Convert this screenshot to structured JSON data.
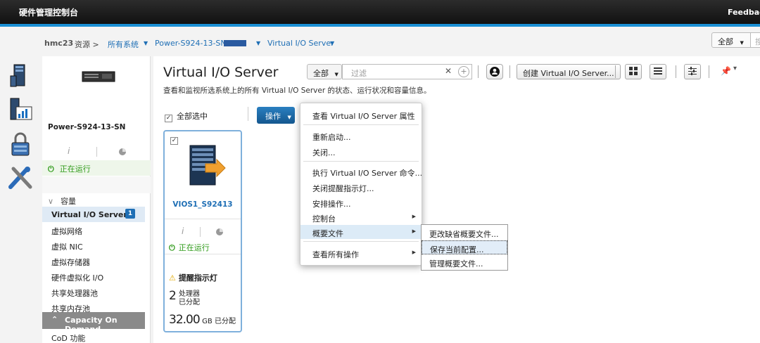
{
  "app": {
    "title": "硬件管理控制台",
    "feedback": "Feedback"
  },
  "breadcrumb": {
    "hmc": "hmc23",
    "resources": "资源 >",
    "all_systems": "所有系统",
    "system": "Power-S924-13-SN",
    "vios": "Virtual I/O Server"
  },
  "scope": {
    "selected": "全部",
    "search_placeholder": "搜"
  },
  "side": {
    "server_name": "Power-S924-13-SN",
    "status": "正在运行",
    "capacity_label": "容量",
    "items": [
      {
        "label": "Virtual I/O Server",
        "badge": "1"
      },
      {
        "label": "虚拟网络"
      },
      {
        "label": "虚拟 NIC"
      },
      {
        "label": "虚拟存储器"
      },
      {
        "label": "硬件虚拟化 I/O"
      },
      {
        "label": "共享处理器池"
      },
      {
        "label": "共享内存池"
      }
    ],
    "cod_header": "Capacity On Demand",
    "cod_item": "CoD 功能"
  },
  "main": {
    "title": "Virtual I/O Server",
    "description": "查看和监视所选系统上的所有 Virtual I/O Server 的状态、运行状况和容量信息。",
    "filter_scope": "全部",
    "filter_placeholder": "过滤",
    "create_button": "创建 Virtual I/O Server...",
    "select_all": "全部选中",
    "operations_button": "操作"
  },
  "card": {
    "name": "VIOS1_S92413",
    "status": "正在运行",
    "alert": "提醒指示灯",
    "processors_value": "2",
    "processors_label": "处理器",
    "processors_sub": "已分配",
    "memory_value": "32.00",
    "memory_label": "GB 已分配"
  },
  "context_menu": {
    "items": [
      "查看 Virtual I/O Server 属性",
      "重新启动...",
      "关闭...",
      "执行 Virtual I/O Server 命令...",
      "关闭提醒指示灯...",
      "安排操作...",
      "控制台",
      "概要文件",
      "查看所有操作"
    ]
  },
  "submenu": {
    "items": [
      "更改缺省概要文件...",
      "保存当前配置...",
      "管理概要文件..."
    ]
  },
  "colors": {
    "accent": "#1a8fd4",
    "running": "#2e9a18",
    "button": "#14578f"
  }
}
